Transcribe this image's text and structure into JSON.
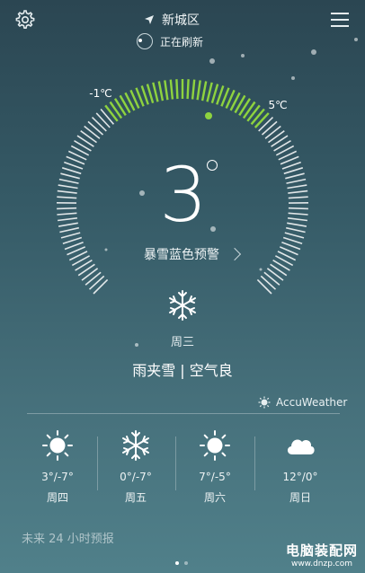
{
  "header": {
    "location": "新城区",
    "refresh_status": "正在刷新"
  },
  "dial": {
    "low_label": "-1℃",
    "high_label": "5℃",
    "current_temp": "3",
    "accent_color": "#8ed33f"
  },
  "alert": {
    "text": "暴雪蓝色预警"
  },
  "today": {
    "weekday": "周三",
    "condition": "雨夹雪 | 空气良",
    "icon": "snowflake-icon"
  },
  "provider": {
    "name": "AccuWeather"
  },
  "forecast": [
    {
      "range": "3°/-7°",
      "day": "周四",
      "icon": "sun-icon"
    },
    {
      "range": "0°/-7°",
      "day": "周五",
      "icon": "snowflake-icon"
    },
    {
      "range": "7°/-5°",
      "day": "周六",
      "icon": "sun-icon"
    },
    {
      "range": "12°/0°",
      "day": "周日",
      "icon": "cloud-icon"
    }
  ],
  "hourly": {
    "label": "未来 24 小时预报"
  },
  "pager": {
    "pages": 2,
    "active": 1
  },
  "watermark": {
    "title": "电脑装配网",
    "url": "www.dnzp.com"
  }
}
